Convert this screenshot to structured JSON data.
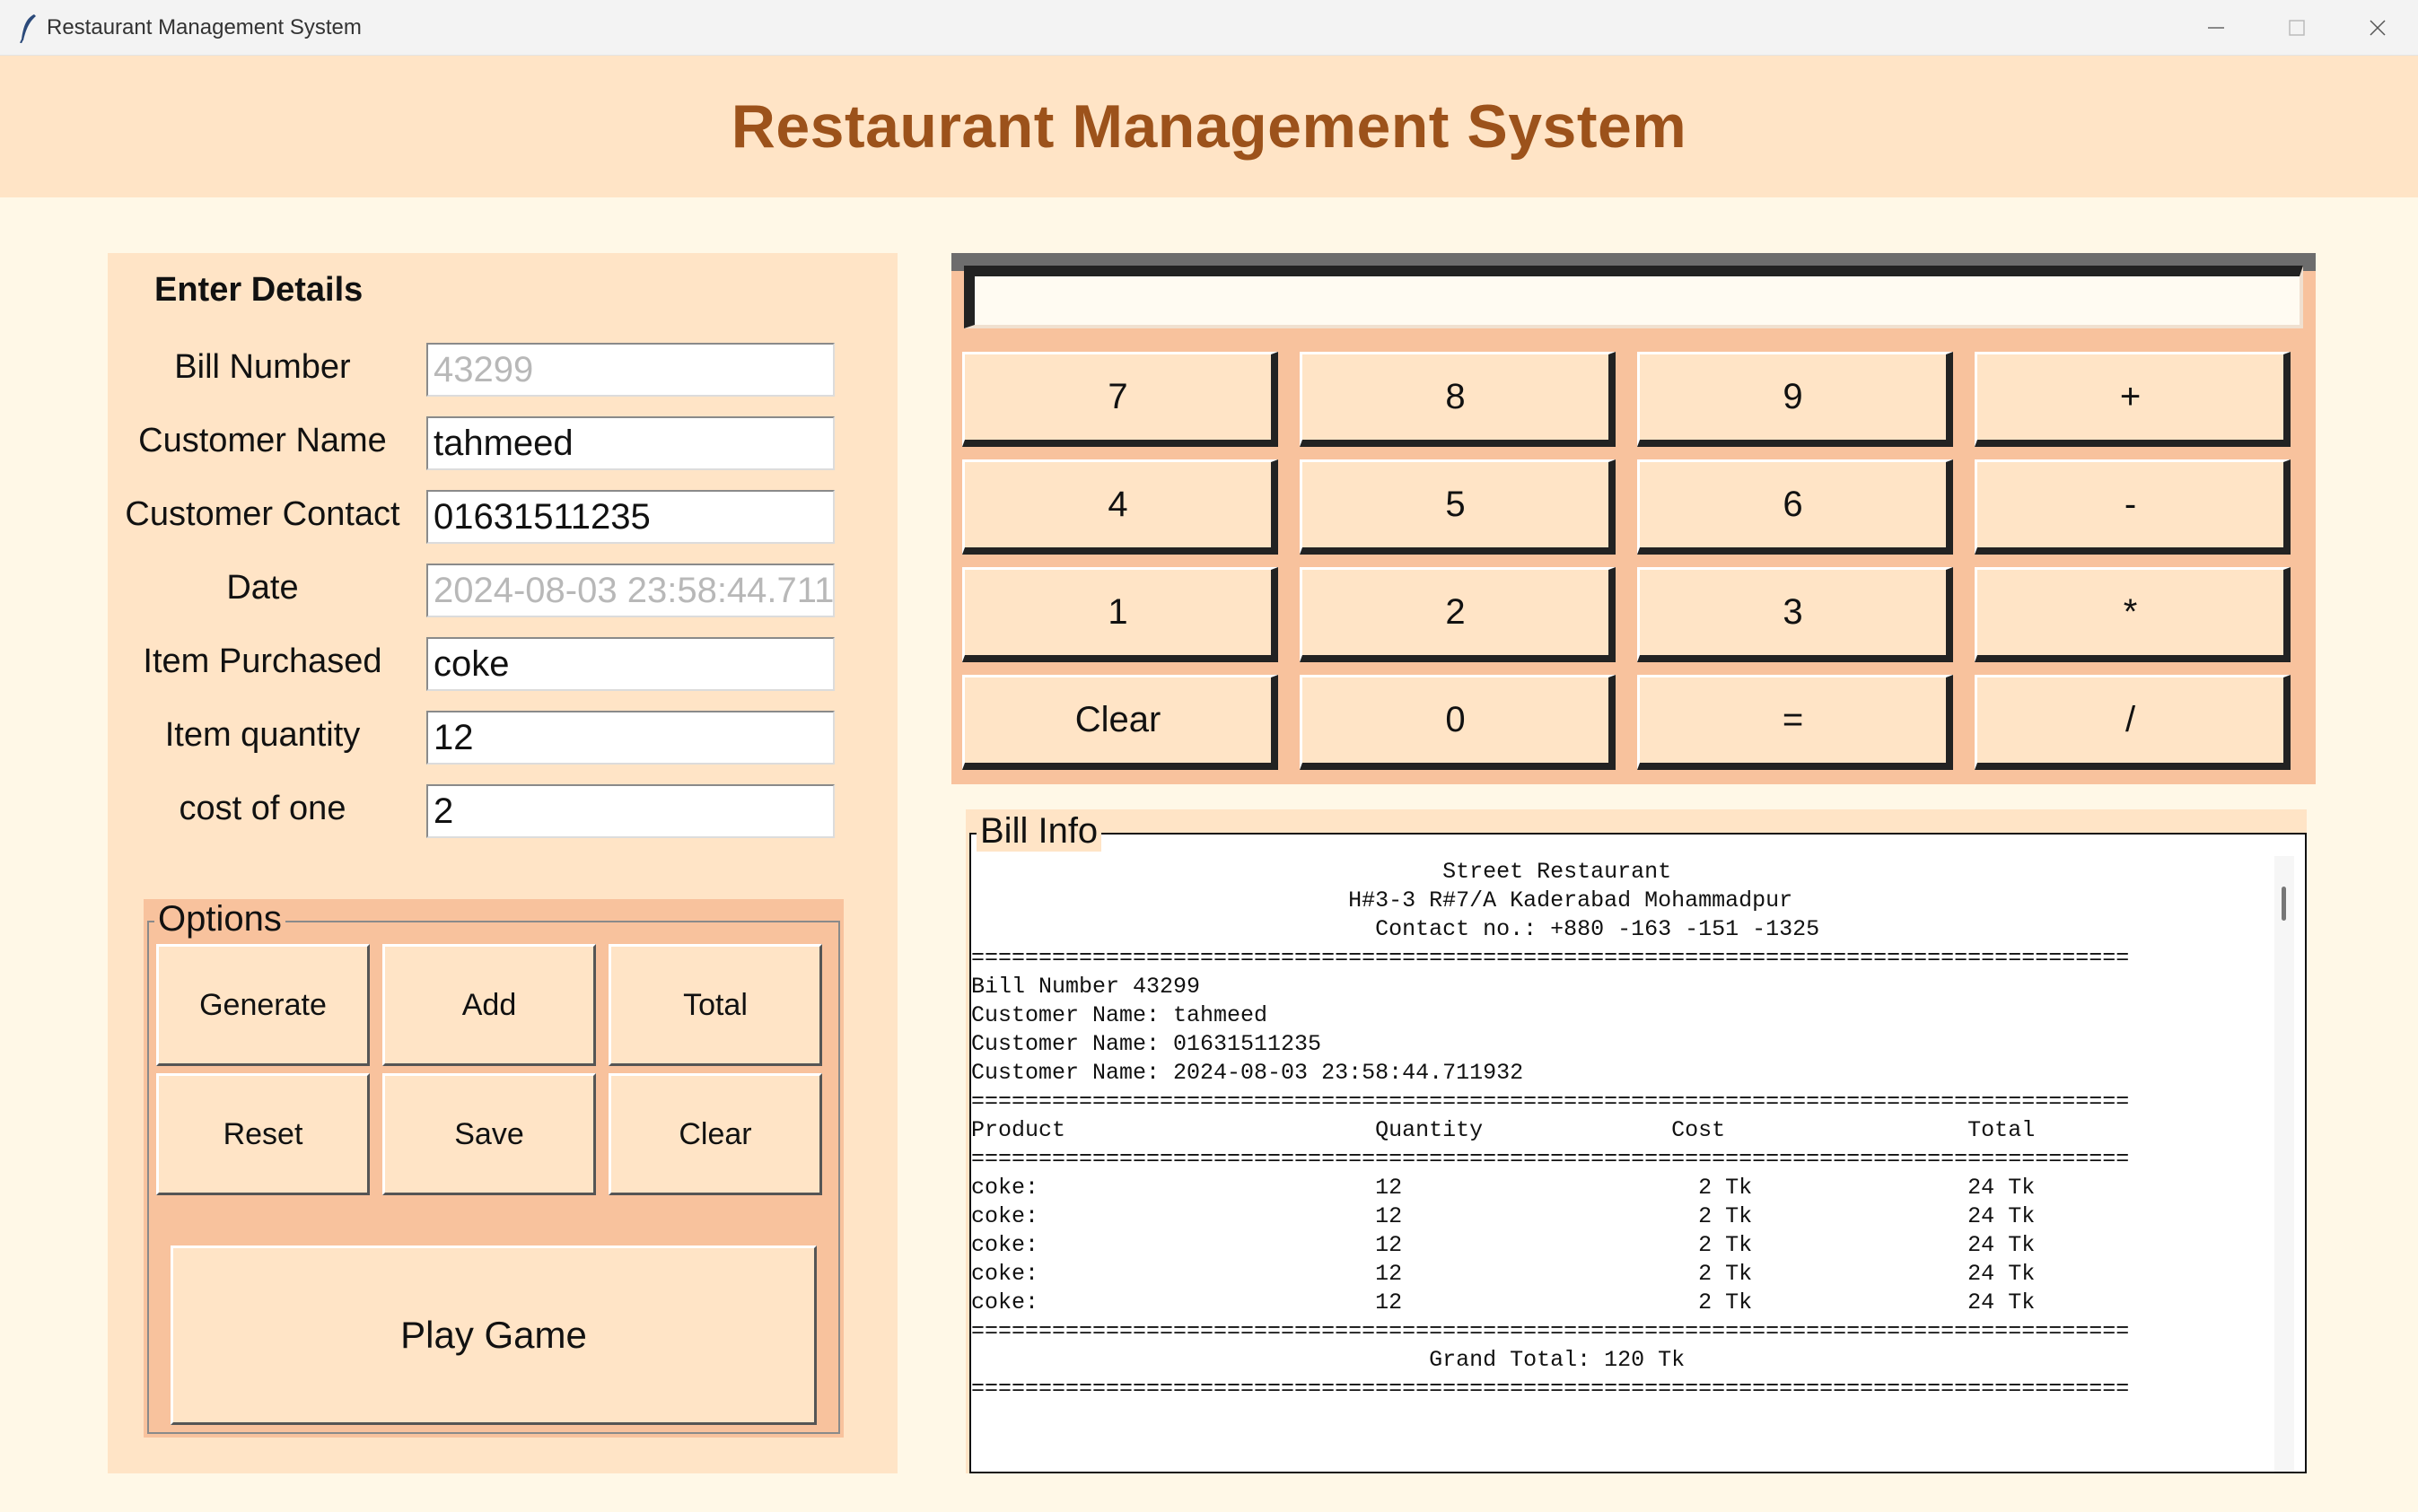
{
  "window": {
    "title": "Restaurant Management System"
  },
  "header": {
    "title": "Restaurant Management System"
  },
  "details": {
    "section_title": "Enter Details",
    "fields": [
      {
        "label": "Bill Number",
        "value": "43299",
        "disabled": true
      },
      {
        "label": "Customer Name",
        "value": "tahmeed",
        "disabled": false
      },
      {
        "label": "Customer Contact",
        "value": "01631511235",
        "disabled": false
      },
      {
        "label": "Date",
        "value": "2024-08-03 23:58:44.711",
        "disabled": true
      },
      {
        "label": "Item Purchased",
        "value": "coke",
        "disabled": false
      },
      {
        "label": "Item quantity",
        "value": "12",
        "disabled": false
      },
      {
        "label": "cost of one",
        "value": "2",
        "disabled": false
      }
    ]
  },
  "options": {
    "label": "Options",
    "buttons": [
      "Generate",
      "Add",
      "Total",
      "Reset",
      "Save",
      "Clear"
    ],
    "play_game": "Play Game"
  },
  "calculator": {
    "display": "",
    "buttons": [
      "7",
      "8",
      "9",
      "+",
      "4",
      "5",
      "6",
      "-",
      "1",
      "2",
      "3",
      "*",
      "Clear",
      "0",
      "=",
      "/"
    ]
  },
  "bill": {
    "label": "Bill Info",
    "lines": [
      "                                   Street Restaurant",
      "                            H#3-3 R#7/A Kaderabad Mohammadpur",
      "                              Contact no.: +880 -163 -151 -1325",
      "======================================================================================",
      "Bill Number 43299",
      "Customer Name: tahmeed",
      "Customer Name: 01631511235",
      "Customer Name: 2024-08-03 23:58:44.711932",
      "======================================================================================",
      "Product                       Quantity              Cost                  Total",
      "======================================================================================",
      "coke:                         12                      2 Tk                24 Tk",
      "coke:                         12                      2 Tk                24 Tk",
      "coke:                         12                      2 Tk                24 Tk",
      "coke:                         12                      2 Tk                24 Tk",
      "coke:                         12                      2 Tk                24 Tk",
      "======================================================================================",
      "                                  Grand Total: 120 Tk",
      "======================================================================================"
    ]
  },
  "colors": {
    "background": "#fff8e7",
    "panel": "#ffe4c6",
    "accent_panel": "#f8c29d",
    "title_text": "#9c521b"
  }
}
